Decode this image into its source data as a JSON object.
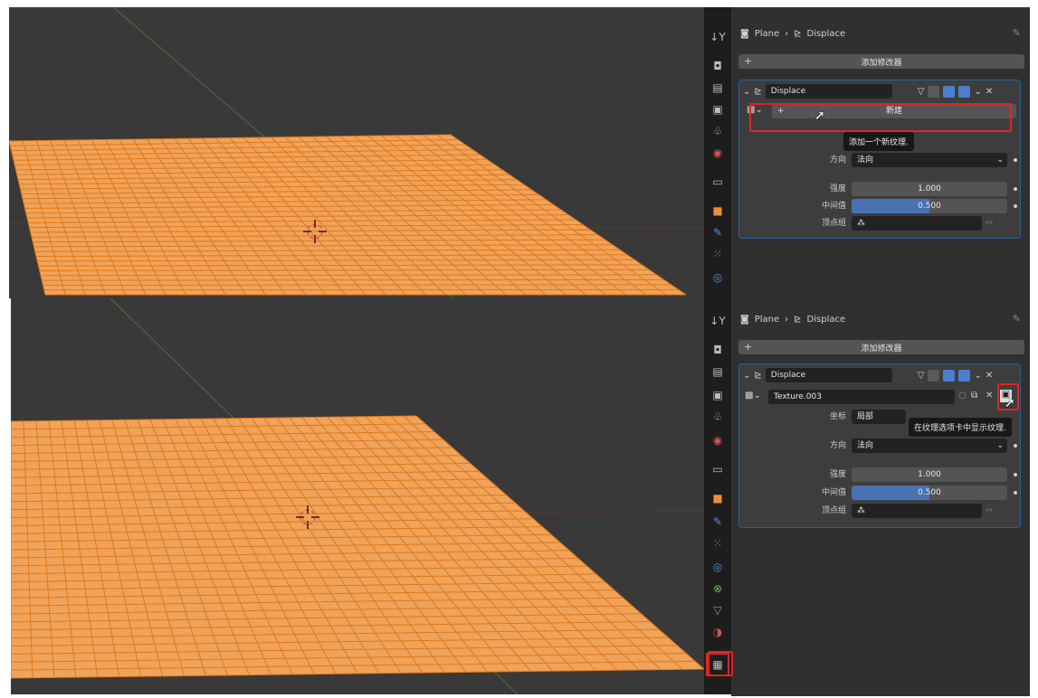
{
  "top": {
    "breadcrumb_object": "Plane",
    "breadcrumb_sep": "›",
    "breadcrumb_modifier": "Displace",
    "add_modifier_label": "添加修改器",
    "modifier_name": "Displace",
    "new_button_label": "新建",
    "tooltip": "添加一个新纹理.",
    "direction_label": "方向",
    "direction_value": "法向",
    "strength_label": "强度",
    "strength_value": "1.000",
    "midlevel_label": "中间值",
    "midlevel_value": "0.500",
    "midlevel_fraction": 0.5,
    "vertex_group_label": "顶点组"
  },
  "bottom": {
    "breadcrumb_object": "Plane",
    "breadcrumb_sep": "›",
    "breadcrumb_modifier": "Displace",
    "add_modifier_label": "添加修改器",
    "modifier_name": "Displace",
    "texture_name": "Texture.003",
    "coords_label": "坐标",
    "coords_value": "局部",
    "tooltip": "在纹理选项卡中显示纹理.",
    "direction_label": "方向",
    "direction_value": "法向",
    "strength_label": "强度",
    "strength_value": "1.000",
    "midlevel_label": "中间值",
    "midlevel_value": "0.500",
    "midlevel_fraction": 0.5,
    "vertex_group_label": "顶点组"
  },
  "colors": {
    "mesh_fill": "#f0a35a",
    "mesh_wire": "#e07818",
    "accent_blue": "#4772b3",
    "highlight_red": "#e02424"
  }
}
